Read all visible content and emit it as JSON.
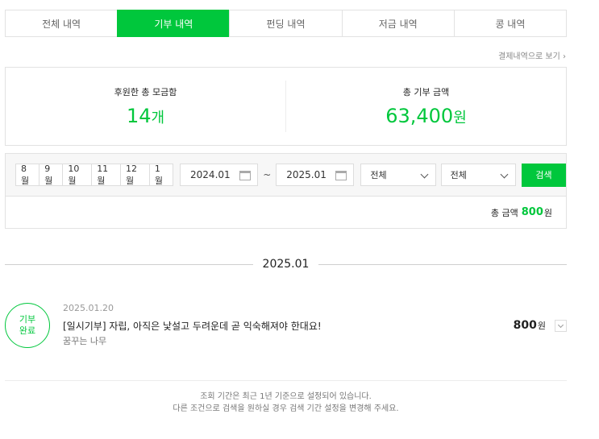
{
  "tabs": [
    {
      "label": "전체 내역",
      "active": false
    },
    {
      "label": "기부 내역",
      "active": true
    },
    {
      "label": "펀딩 내역",
      "active": false
    },
    {
      "label": "저금 내역",
      "active": false
    },
    {
      "label": "콩 내역",
      "active": false
    }
  ],
  "payment_link": "결제내역으로 보기",
  "summary": {
    "count_label": "후원한 총 모금함",
    "count_value": "14",
    "count_unit": "개",
    "amount_label": "총 기부 금액",
    "amount_value": "63,400",
    "amount_unit": "원"
  },
  "filter": {
    "months": [
      "8월",
      "9월",
      "10월",
      "11월",
      "12월",
      "1월"
    ],
    "start_date": "2024.01",
    "tilde": "~",
    "end_date": "2025.01",
    "select1": "전체",
    "select2": "전체",
    "search_label": "검색",
    "total_label": "총 금액",
    "total_amount": "800",
    "total_unit": "원"
  },
  "group_date": "2025.01",
  "item": {
    "badge_line1": "기부",
    "badge_line2": "완료",
    "date": "2025.01.20",
    "title": "[일시기부] 자립, 아직은 낯설고 두려운데 곧 익숙해져야 한대요!",
    "org": "꿈꾸는 나무",
    "amount": "800",
    "unit": "원"
  },
  "notice": {
    "line1": "조회 기간은 최근 1년 기준으로 설정되어 있습니다.",
    "line2": "다른 조건으로 검색을 원하실 경우 검색 기간 설정을 변경해 주세요."
  },
  "colors": {
    "accent": "#00c73c",
    "border": "#e2e2e2"
  }
}
